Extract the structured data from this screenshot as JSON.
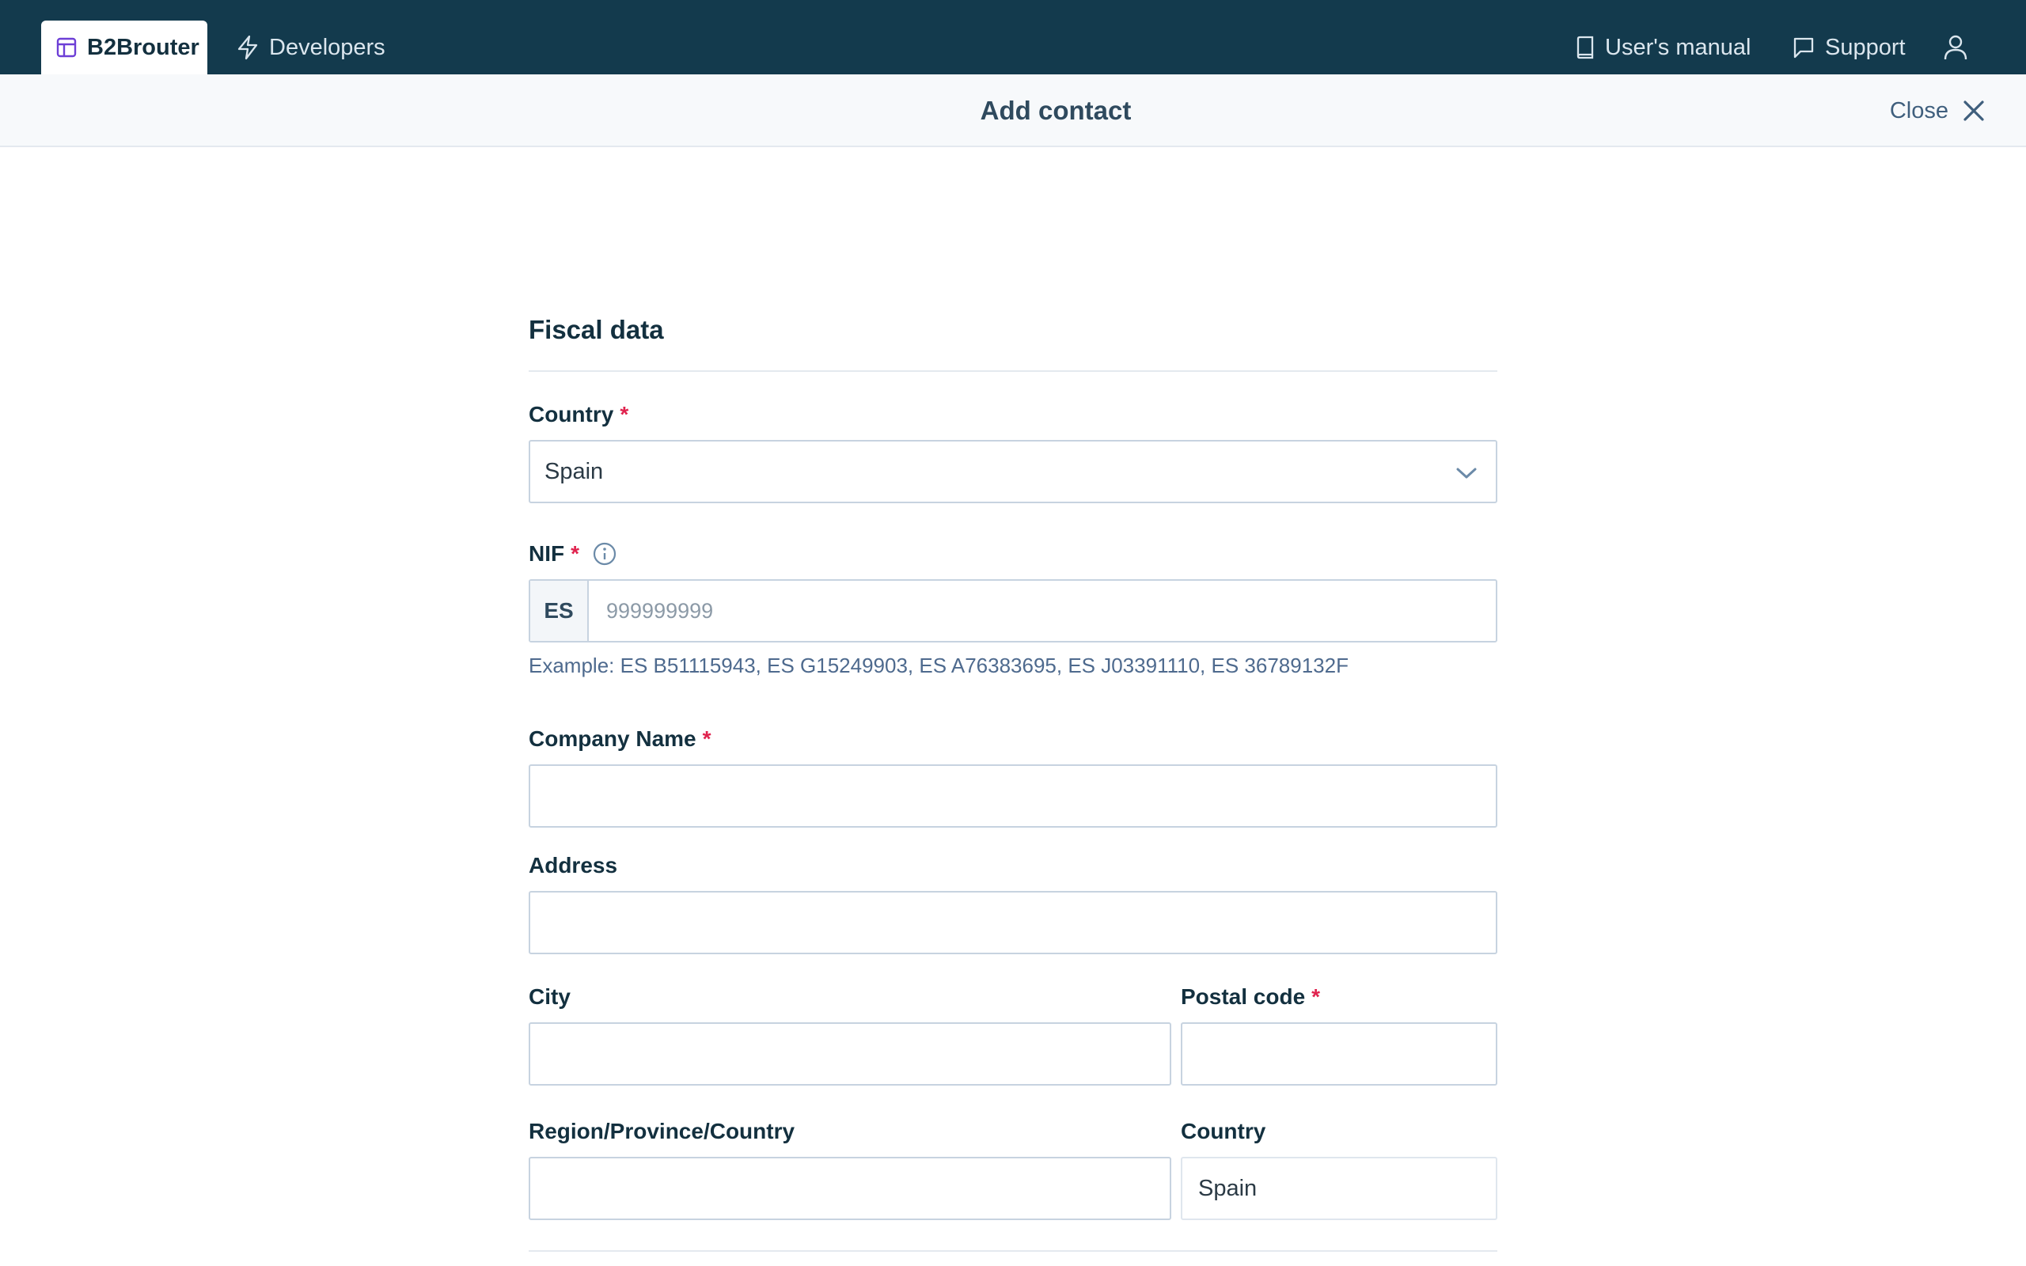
{
  "nav": {
    "brand_tab": "B2Brouter",
    "developers_tab": "Developers",
    "users_manual": "User's manual",
    "support": "Support"
  },
  "header": {
    "title": "Add contact",
    "close": "Close"
  },
  "form": {
    "section_title": "Fiscal data",
    "required_marker": "*",
    "country_label": "Country",
    "country_value": "Spain",
    "nif_label": "NIF",
    "nif_prefix": "ES",
    "nif_placeholder": "999999999",
    "nif_hint": "Example: ES B51115943, ES G15249903, ES A76383695, ES J03391110, ES 36789132F",
    "company_name_label": "Company Name",
    "address_label": "Address",
    "city_label": "City",
    "postal_code_label": "Postal code",
    "region_label": "Region/Province/Country",
    "country2_label": "Country",
    "country2_value": "Spain"
  },
  "icons": {
    "brand": "layout-icon",
    "developers": "lightning-icon",
    "manual": "book-icon",
    "support": "chat-bubble-icon",
    "user": "user-icon",
    "close": "close-icon",
    "info": "info-icon",
    "select": "chevron-down-icon"
  },
  "colors": {
    "topbar": "#133a4d",
    "brand_icon": "#6d3fd6",
    "required": "#e0234e",
    "hint": "#4e6a8e"
  }
}
